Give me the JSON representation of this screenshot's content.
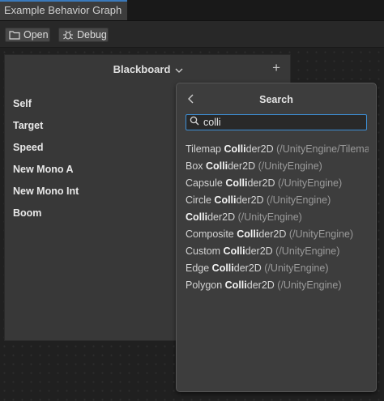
{
  "window": {
    "tab_title": "Example Behavior Graph"
  },
  "toolbar": {
    "open_label": "Open",
    "debug_label": "Debug"
  },
  "blackboard": {
    "title": "Blackboard",
    "add_label": "+",
    "variables": [
      "Self",
      "Target",
      "Speed",
      "New Mono A",
      "New Mono Int",
      "Boom"
    ]
  },
  "search": {
    "title": "Search",
    "query": "colli",
    "results": [
      {
        "pre": "Tilemap ",
        "match": "Colli",
        "post": "der2D",
        "path": "(/UnityEngine/Tilema..."
      },
      {
        "pre": "Box ",
        "match": "Colli",
        "post": "der2D",
        "path": "(/UnityEngine)"
      },
      {
        "pre": "Capsule ",
        "match": "Colli",
        "post": "der2D",
        "path": "(/UnityEngine)"
      },
      {
        "pre": "Circle ",
        "match": "Colli",
        "post": "der2D",
        "path": "(/UnityEngine)"
      },
      {
        "pre": "",
        "match": "Colli",
        "post": "der2D",
        "path": "(/UnityEngine)"
      },
      {
        "pre": "Composite ",
        "match": "Colli",
        "post": "der2D",
        "path": "(/UnityEngine)"
      },
      {
        "pre": "Custom ",
        "match": "Colli",
        "post": "der2D",
        "path": "(/UnityEngine)"
      },
      {
        "pre": "Edge ",
        "match": "Colli",
        "post": "der2D",
        "path": "(/UnityEngine)"
      },
      {
        "pre": "Polygon ",
        "match": "Colli",
        "post": "der2D",
        "path": "(/UnityEngine)"
      }
    ]
  },
  "colors": {
    "accent": "#3d8fd6",
    "panel": "#383838",
    "popup": "#3d3d3d"
  }
}
